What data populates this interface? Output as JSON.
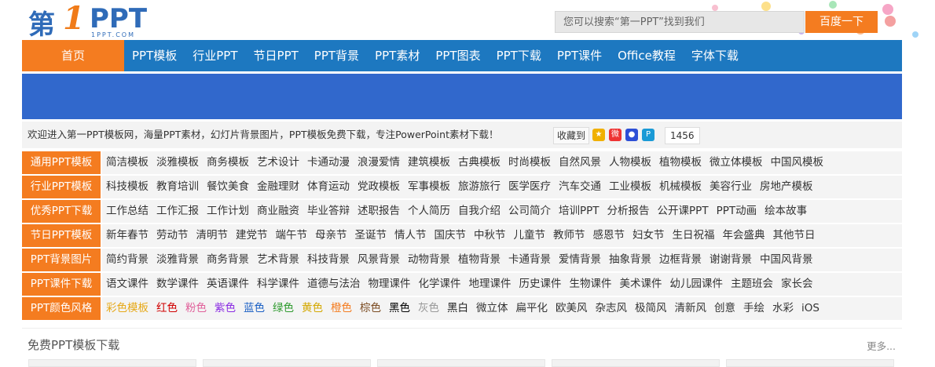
{
  "logo": {
    "main": "第",
    "one": "1",
    "ppt": "PPT",
    "domain": "1PPT.COM"
  },
  "search": {
    "placeholder": "您可以搜索“第一PPT”找到我们",
    "button": "百度一下"
  },
  "nav": {
    "home": "首页",
    "items": [
      "PPT模板",
      "行业PPT",
      "节日PPT",
      "PPT背景",
      "PPT素材",
      "PPT图表",
      "PPT下载",
      "PPT课件",
      "Office教程",
      "字体下载"
    ]
  },
  "welcome": {
    "text": "欢迎进入第一PPT模板网，海量PPT素材，幻灯片背景图片，PPT模板免费下载，专注PowerPoint素材下载！",
    "fav_label": "收藏到",
    "count": "1456",
    "share_icons": [
      "qq-space-icon",
      "weibo-icon",
      "baidu-icon",
      "shortcut-icon"
    ]
  },
  "categories": [
    {
      "label": "通用PPT模板",
      "links": [
        "简洁模板",
        "淡雅模板",
        "商务模板",
        "艺术设计",
        "卡通动漫",
        "浪漫爱情",
        "建筑模板",
        "古典模板",
        "时尚模板",
        "自然风景",
        "人物模板",
        "植物模板",
        "微立体模板",
        "中国风模板"
      ]
    },
    {
      "label": "行业PPT模板",
      "links": [
        "科技模板",
        "教育培训",
        "餐饮美食",
        "金融理财",
        "体育运动",
        "党政模板",
        "军事模板",
        "旅游旅行",
        "医学医疗",
        "汽车交通",
        "工业模板",
        "机械模板",
        "美容行业",
        "房地产模板"
      ]
    },
    {
      "label": "优秀PPT下载",
      "links": [
        "工作总结",
        "工作汇报",
        "工作计划",
        "商业融资",
        "毕业答辩",
        "述职报告",
        "个人简历",
        "自我介绍",
        "公司简介",
        "培训PPT",
        "分析报告",
        "公开课PPT",
        "PPT动画",
        "绘本故事"
      ]
    },
    {
      "label": "节日PPT模板",
      "links": [
        "新年春节",
        "劳动节",
        "清明节",
        "建党节",
        "端午节",
        "母亲节",
        "圣诞节",
        "情人节",
        "国庆节",
        "中秋节",
        "儿童节",
        "教师节",
        "感恩节",
        "妇女节",
        "生日祝福",
        "年会盛典",
        "其他节日"
      ]
    },
    {
      "label": "PPT背景图片",
      "links": [
        "简约背景",
        "淡雅背景",
        "商务背景",
        "艺术背景",
        "科技背景",
        "风景背景",
        "动物背景",
        "植物背景",
        "卡通背景",
        "爱情背景",
        "抽象背景",
        "边框背景",
        "谢谢背景",
        "中国风背景"
      ]
    },
    {
      "label": "PPT课件下载",
      "links": [
        "语文课件",
        "数学课件",
        "英语课件",
        "科学课件",
        "道德与法治",
        "物理课件",
        "化学课件",
        "地理课件",
        "历史课件",
        "生物课件",
        "美术课件",
        "幼儿园课件",
        "主题班会",
        "家长会"
      ]
    },
    {
      "label": "PPT颜色风格",
      "links": [
        "彩色模板",
        "红色",
        "粉色",
        "紫色",
        "蓝色",
        "绿色",
        "黄色",
        "橙色",
        "棕色",
        "黑色",
        "灰色",
        "黑白",
        "微立体",
        "扁平化",
        "欧美风",
        "杂志风",
        "极简风",
        "清新风",
        "创意",
        "手绘",
        "水彩",
        "iOS"
      ]
    }
  ],
  "color_links": {
    "彩色模板": "#e6a817",
    "红色": "#d00000",
    "粉色": "#e0609a",
    "紫色": "#8a2be2",
    "蓝色": "#1a5fc4",
    "绿色": "#2e9a2e",
    "黄色": "#d4a800",
    "橙色": "#f47c20",
    "棕色": "#7a4a20",
    "黑色": "#000000",
    "灰色": "#999999",
    "黑白": "#222222"
  },
  "free": {
    "title": "免费PPT模板下载",
    "more": "更多..."
  },
  "colors": {
    "orange": "#f47c20",
    "nav_blue": "#1d78c0",
    "banner_blue": "#3168cc"
  }
}
